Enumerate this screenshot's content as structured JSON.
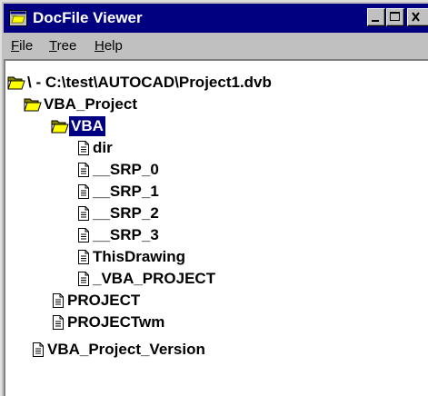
{
  "window": {
    "title": "DocFile Viewer",
    "title_icon": "docfile-viewer-app-icon",
    "controls": [
      "minimize-icon",
      "maximize-icon",
      "close-icon"
    ]
  },
  "menu": {
    "file_accel": "F",
    "file_rest": "ile",
    "tree_accel": "T",
    "tree_rest": "ree",
    "help_accel": "H",
    "help_rest": "elp"
  },
  "tree": {
    "root": "\\ - C:\\test\\AUTOCAD\\Project1.dvb",
    "vba_project": "VBA_Project",
    "vba": "VBA",
    "dir": "dir",
    "srp_0": "__SRP_0",
    "srp_1": "__SRP_1",
    "srp_2": "__SRP_2",
    "srp_3": "__SRP_3",
    "this_drawing": "ThisDrawing",
    "vba_project_stream": "_VBA_PROJECT",
    "project": "PROJECT",
    "projectwm": "PROJECTwm",
    "vba_project_version": "VBA_Project_Version"
  },
  "selected_node": "VBA",
  "icons": {
    "storage": "open-folder-icon",
    "stream": "document-icon"
  },
  "colors": {
    "title_bar": "#000080",
    "selection": "#000080",
    "face": "#c0c0c0",
    "tree_bg": "#ffffff"
  }
}
